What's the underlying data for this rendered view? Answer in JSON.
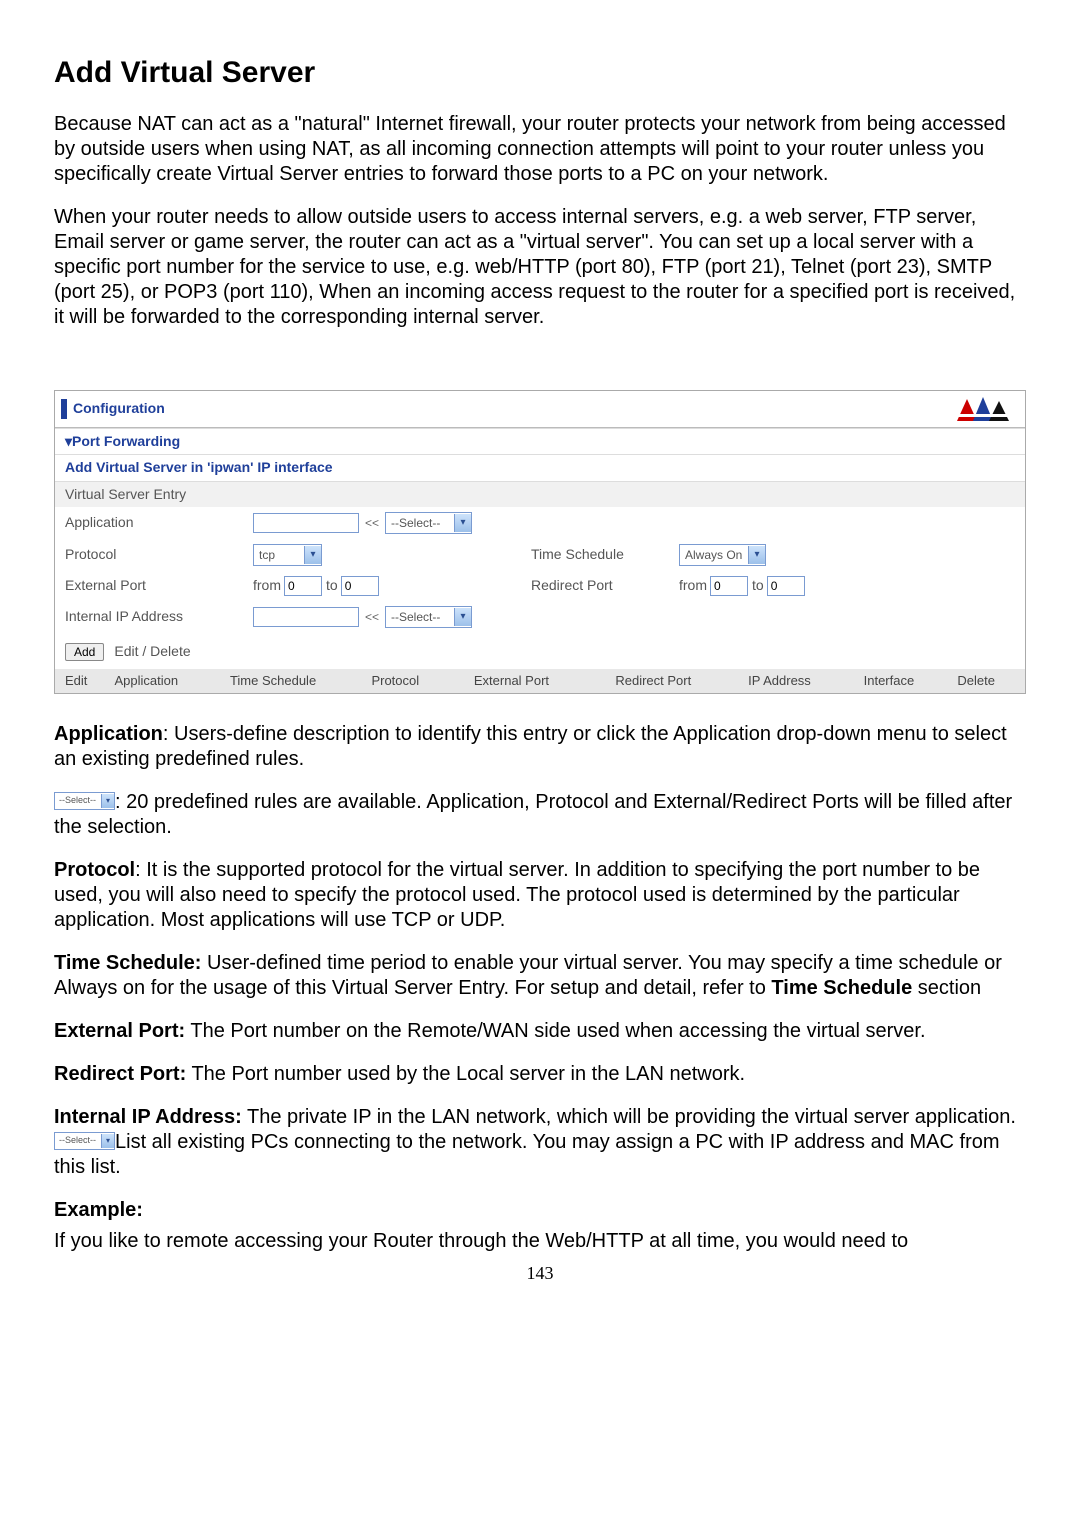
{
  "title": "Add Virtual Server",
  "intro": [
    "Because NAT can act as a \"natural\" Internet firewall, your router protects your network from being accessed by outside users when using NAT, as all incoming connection attempts will point to your router unless you specifically create Virtual Server entries to forward those ports to a PC on your network.",
    "When your router needs to allow outside users to access internal servers, e.g. a web server, FTP server, Email server or game server, the router can act as a \"virtual server\". You can set up a local server with a specific port number for the service to use, e.g. web/HTTP (port 80), FTP (port 21), Telnet (port 23), SMTP (port 25), or POP3 (port 110), When an incoming access request to the router for a specified port is received, it will be forwarded to the corresponding internal server."
  ],
  "panel": {
    "header": "Configuration",
    "section1": "▾Port Forwarding",
    "section2": "Add Virtual Server in 'ipwan' IP interface",
    "section3": "Virtual Server Entry",
    "labels": {
      "application": "Application",
      "protocol": "Protocol",
      "time_schedule": "Time Schedule",
      "external_port": "External Port",
      "redirect_port": "Redirect Port",
      "internal_ip": "Internal IP Address"
    },
    "values": {
      "application_input": "",
      "app_select": "--Select--",
      "protocol_select": "tcp",
      "time_select": "Always On",
      "ext_from": "0",
      "ext_to": "0",
      "red_from": "0",
      "red_to": "0",
      "internal_ip_input": "",
      "ip_select": "--Select--",
      "arrow": "<<",
      "from": "from",
      "to": "to"
    },
    "buttons": {
      "add": "Add",
      "edit_delete": "Edit / Delete"
    },
    "table_headers": {
      "edit": "Edit",
      "application": "Application",
      "time_schedule": "Time Schedule",
      "protocol": "Protocol",
      "external_port": "External Port",
      "redirect_port": "Redirect Port",
      "ip_address": "IP Address",
      "interface": "Interface",
      "delete": "Delete"
    }
  },
  "defs": {
    "application": {
      "label": "Application",
      "text": ": Users-define description to identify this entry or click the Application drop-down menu to select an existing predefined rules."
    },
    "select_note": ": 20 predefined rules are available.  Application, Protocol and External/Redirect Ports will be filled after the selection.",
    "protocol": {
      "label": "Protocol",
      "text": ": It is the supported protocol for the virtual server. In addition to specifying the port number to be used, you will also need to specify the protocol used. The protocol used is determined by the particular application. Most applications will use TCP or UDP."
    },
    "time_schedule": {
      "label": "Time Schedule:",
      "text": " User-defined time period to enable your virtual server.  You may specify a time schedule or Always on for the usage of this Virtual Server Entry.  For setup and detail, refer to ",
      "link": "Time Schedule",
      "after": " section"
    },
    "external_port": {
      "label": "External Port:",
      "text": " The Port number on the Remote/WAN side used when accessing the virtual server."
    },
    "redirect_port": {
      "label": "Redirect Port:",
      "text": " The Port number used by the Local server in the LAN network."
    },
    "internal_ip": {
      "label": "Internal IP Address:",
      "text": " The private IP in the LAN network, which will be providing the virtual server application.  ",
      "after": "List all existing PCs connecting to the network. You may assign a PC with IP address and MAC from this list."
    },
    "example_label": "Example:",
    "example_text": "If you like to remote accessing your Router through the Web/HTTP at all time, you would need to"
  },
  "inline_select": "--Select--",
  "page_number": "143"
}
